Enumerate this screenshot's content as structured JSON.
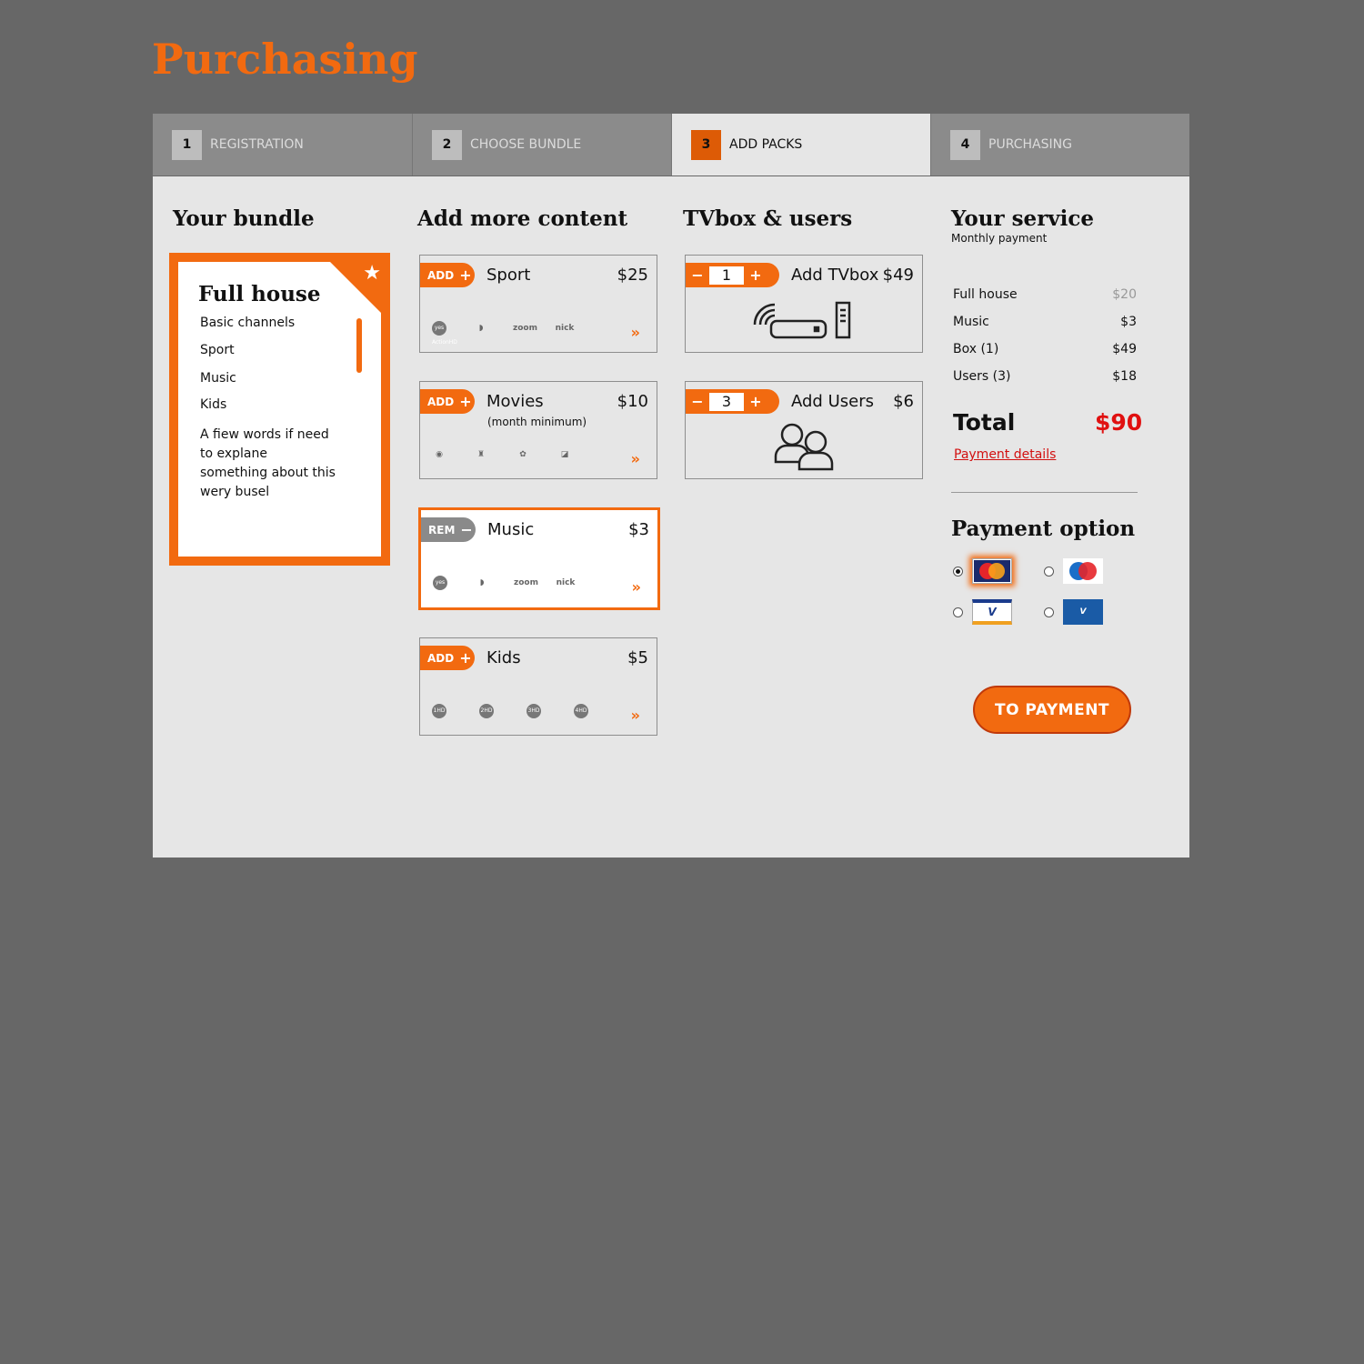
{
  "page": {
    "title": "Purchasing"
  },
  "steps": [
    {
      "num": "1",
      "label": "REGISTRATION"
    },
    {
      "num": "2",
      "label": "CHOOSE BUNDLE"
    },
    {
      "num": "3",
      "label": "ADD PACKS"
    },
    {
      "num": "4",
      "label": "PURCHASING"
    }
  ],
  "bundle": {
    "heading": "Your bundle",
    "name": "Full house",
    "items": [
      "Basic channels",
      "Sport",
      "Music",
      "Kids"
    ],
    "description": "A fiew words if need to explane something about this wery busel"
  },
  "content": {
    "heading": "Add more content",
    "packs": [
      {
        "action": "ADD",
        "symbol": "+",
        "name": "Sport",
        "price": "$25",
        "note": "",
        "logos": [
          "yes ActionHD",
          "zoom",
          "nick"
        ]
      },
      {
        "action": "ADD",
        "symbol": "+",
        "name": "Movies",
        "price": "$10",
        "note": "(month minimum)",
        "logos": []
      },
      {
        "action": "REM",
        "symbol": "−",
        "name": "Music",
        "price": "$3",
        "note": "",
        "logos": [
          "yes ActionHD",
          "zoom",
          "nick"
        ]
      },
      {
        "action": "ADD",
        "symbol": "+",
        "name": "Kids",
        "price": "$5",
        "note": "",
        "logos": [
          "1HD",
          "2HD",
          "3HD",
          "4HD"
        ]
      }
    ]
  },
  "tvbox": {
    "heading": "TVbox & users",
    "box": {
      "qty": "1",
      "label": "Add TVbox",
      "price": "$49"
    },
    "users": {
      "qty": "3",
      "label": "Add Users",
      "price": "$6"
    }
  },
  "service": {
    "heading": "Your service",
    "subheading": "Monthly payment",
    "rows": [
      {
        "label": "Full house",
        "value": "$20"
      },
      {
        "label": "Music",
        "value": "$3"
      },
      {
        "label": "Box (1)",
        "value": "$49"
      },
      {
        "label": "Users (3)",
        "value": "$18"
      }
    ],
    "total_label": "Total",
    "total_value": "$90",
    "details_link": "Payment details"
  },
  "payment": {
    "heading": "Payment option",
    "options": [
      "MasterCard",
      "Maestro",
      "VISA",
      "VISA Electron"
    ],
    "selected": "MasterCard",
    "button": "TO PAYMENT"
  },
  "colors": {
    "accent": "#f26a10",
    "total": "#e01010",
    "background": "#676767",
    "panel": "#e6e6e6"
  }
}
